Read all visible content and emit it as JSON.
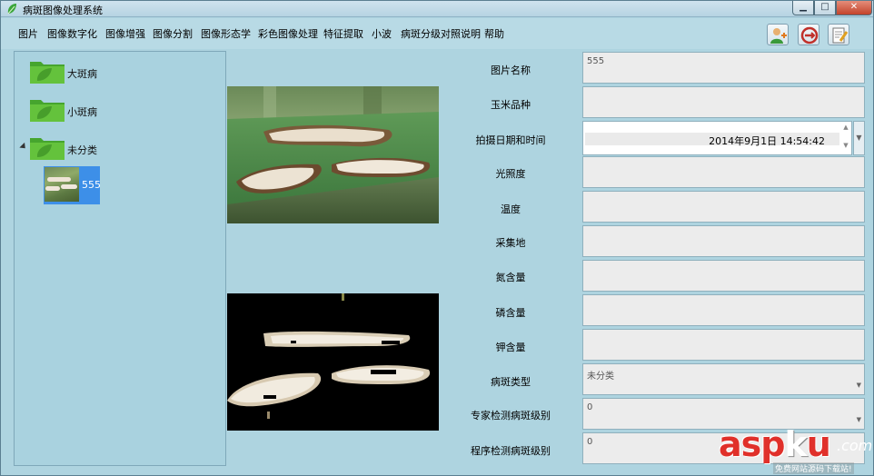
{
  "window": {
    "title": "病斑图像处理系统",
    "min_glyph": "▁",
    "max_glyph": "□",
    "close_glyph": "✕"
  },
  "menu": [
    "图片",
    "图像数字化",
    "图像增强",
    "图像分割",
    "图像形态学",
    "彩色图像处理",
    "特征提取",
    "小波",
    "病斑分级对照说明",
    "帮助"
  ],
  "toolbar_icons": [
    "user-add-icon",
    "refresh-icon",
    "edit-note-icon"
  ],
  "tree": {
    "nodes": [
      {
        "label": "大斑病",
        "icon": "folder-leaf-icon"
      },
      {
        "label": "小斑病",
        "icon": "folder-leaf-icon"
      },
      {
        "label": "未分类",
        "icon": "folder-leaf-icon",
        "expanded": true
      }
    ],
    "child": {
      "label": "555"
    }
  },
  "form": {
    "labels": [
      "图片名称",
      "玉米品种",
      "拍摄日期和时间",
      "光照度",
      "温度",
      "采集地",
      "氮含量",
      "磷含量",
      "钾含量",
      "病斑类型",
      "专家检测病斑级别",
      "程序检测病斑级别"
    ],
    "values": {
      "image_name": "555",
      "datetime": "2014年9月1日 14:54:42",
      "spot_type": "未分类",
      "expert_level": "0",
      "program_level": "0"
    }
  },
  "watermark": {
    "main_a": "asp",
    "main_b": "k",
    "main_c": "u",
    "com": ".com",
    "sub": "免费网站源码下载站!"
  },
  "colors": {
    "background": "#aed4e0",
    "selection": "#3d8fe8",
    "watermark_red": "#e0302a"
  }
}
